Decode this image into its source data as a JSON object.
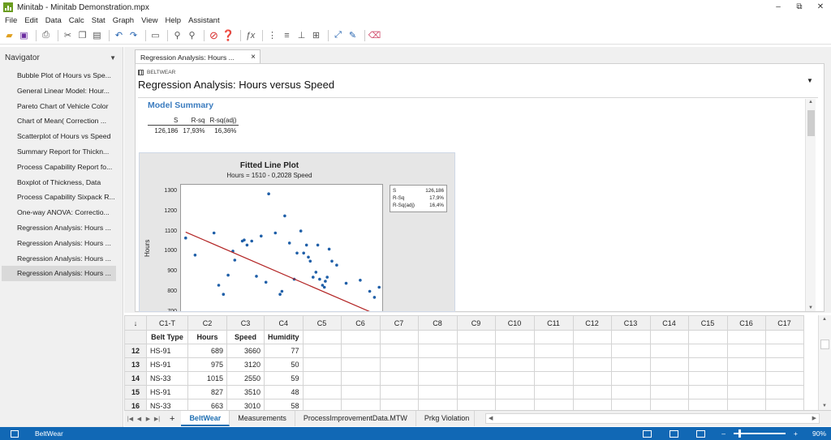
{
  "window": {
    "title": "Minitab - Minitab Demonstration.mpx",
    "minimize": "–",
    "restore": "⧉",
    "close": "✕"
  },
  "menu": [
    "File",
    "Edit",
    "Data",
    "Calc",
    "Stat",
    "Graph",
    "View",
    "Help",
    "Assistant"
  ],
  "toolbar": {
    "icons": [
      "open-icon",
      "save-icon",
      "print-icon",
      "cut-icon",
      "copy-icon",
      "paste-icon",
      "undo-icon",
      "redo-icon",
      "window-icon",
      "find-icon",
      "find-next-icon",
      "cancel-icon",
      "help-icon",
      "formula-icon",
      "column-icon",
      "row-icon",
      "insert-icon",
      "brush-icon",
      "graph-tools-icon",
      "graph-edit-icon",
      "eraser-icon"
    ],
    "accent_cancel": "#d62b2b",
    "accent_help": "#1f5fae"
  },
  "navigator": {
    "title": "Navigator",
    "items": [
      "Bubble Plot of Hours vs Spe...",
      "General Linear Model: Hour...",
      "Pareto Chart of Vehicle Color",
      "Chart of Mean( Correction ...",
      "Scatterplot of Hours vs Speed",
      "Summary Report for Thickn...",
      "Process Capability Report fo...",
      "Boxplot of Thickness, Data",
      "Process Capability Sixpack R...",
      "One-way ANOVA: Correctio...",
      "Regression Analysis: Hours ...",
      "Regression Analysis: Hours ...",
      "Regression Analysis: Hours ...",
      "Regression Analysis: Hours ..."
    ],
    "selected_index": 13
  },
  "output": {
    "tab_label": "Regression Analysis: Hours ...",
    "tab_close": "×",
    "worksheet": "BELTWEAR",
    "title": "Regression Analysis: Hours versus Speed",
    "model_summary": {
      "heading": "Model Summary",
      "headers": [
        "S",
        "R-sq",
        "R-sq(adj)"
      ],
      "values": [
        "126,186",
        "17,93%",
        "16,36%"
      ]
    }
  },
  "plot": {
    "title": "Fitted Line Plot",
    "subtitle": "Hours = 1510 - 0,2028 Speed",
    "ylabel": "Hours",
    "yticks": [
      "1300",
      "1200",
      "1100",
      "1000",
      "900",
      "800",
      "700"
    ],
    "stats": [
      [
        "S",
        "126,186"
      ],
      [
        "R-Sq",
        "17,9%"
      ],
      [
        "R-Sq(adj)",
        "16,4%"
      ]
    ],
    "point_color": "#1f5fa8",
    "line_color": "#b22222"
  },
  "chart_data": {
    "type": "scatter",
    "title": "Fitted Line Plot",
    "subtitle": "Hours = 1510 - 0,2028 Speed",
    "xlabel": "",
    "ylabel": "Hours",
    "ylim": [
      695,
      1340
    ],
    "xlim": [
      1950,
      4100
    ],
    "fit": {
      "intercept": 1510,
      "slope": -0.2028
    },
    "points": [
      [
        2000,
        1075
      ],
      [
        2100,
        990
      ],
      [
        2300,
        1100
      ],
      [
        2350,
        840
      ],
      [
        2400,
        795
      ],
      [
        2450,
        890
      ],
      [
        2500,
        1010
      ],
      [
        2520,
        965
      ],
      [
        2600,
        1060
      ],
      [
        2620,
        1065
      ],
      [
        2650,
        1040
      ],
      [
        2700,
        1060
      ],
      [
        2750,
        885
      ],
      [
        2800,
        1085
      ],
      [
        2850,
        855
      ],
      [
        2880,
        1295
      ],
      [
        2950,
        1100
      ],
      [
        3000,
        795
      ],
      [
        3020,
        810
      ],
      [
        3050,
        1185
      ],
      [
        3100,
        1050
      ],
      [
        3150,
        870
      ],
      [
        3180,
        1000
      ],
      [
        3220,
        1110
      ],
      [
        3250,
        1000
      ],
      [
        3280,
        1040
      ],
      [
        3300,
        980
      ],
      [
        3320,
        960
      ],
      [
        3350,
        880
      ],
      [
        3380,
        905
      ],
      [
        3400,
        1040
      ],
      [
        3420,
        870
      ],
      [
        3450,
        840
      ],
      [
        3470,
        830
      ],
      [
        3480,
        860
      ],
      [
        3500,
        880
      ],
      [
        3520,
        1020
      ],
      [
        3550,
        960
      ],
      [
        3600,
        940
      ],
      [
        3700,
        850
      ],
      [
        3850,
        865
      ],
      [
        3950,
        810
      ],
      [
        4000,
        780
      ],
      [
        4050,
        830
      ],
      [
        3300,
        700
      ],
      [
        3350,
        700
      ],
      [
        4150,
        700
      ]
    ]
  },
  "sheet": {
    "row_icon": "↓",
    "columns": [
      "C1-T",
      "C2",
      "C3",
      "C4",
      "C5",
      "C6",
      "C7",
      "C8",
      "C9",
      "C10",
      "C11",
      "C12",
      "C13",
      "C14",
      "C15",
      "C16",
      "C17"
    ],
    "names": [
      "Belt Type",
      "Hours",
      "Speed",
      "Humidity",
      "",
      "",
      "",
      "",
      "",
      "",
      "",
      "",
      "",
      "",
      "",
      "",
      ""
    ],
    "rows": [
      {
        "n": "12",
        "c": [
          "HS-91",
          "689",
          "3660",
          "77"
        ]
      },
      {
        "n": "13",
        "c": [
          "HS-91",
          "975",
          "3120",
          "50"
        ]
      },
      {
        "n": "14",
        "c": [
          "NS-33",
          "1015",
          "2550",
          "59"
        ]
      },
      {
        "n": "15",
        "c": [
          "HS-91",
          "827",
          "3510",
          "48"
        ]
      },
      {
        "n": "16",
        "c": [
          "NS-33",
          "663",
          "3010",
          "58"
        ]
      }
    ]
  },
  "sheet_tabs": {
    "add": "+",
    "tabs": [
      "BeltWear",
      "Measurements",
      "ProcessImprovementData.MTW",
      "Prkg Violation"
    ],
    "active": 0
  },
  "status": {
    "text": "BeltWear",
    "zoom": "90%",
    "zoom_minus": "–",
    "zoom_plus": "+"
  }
}
